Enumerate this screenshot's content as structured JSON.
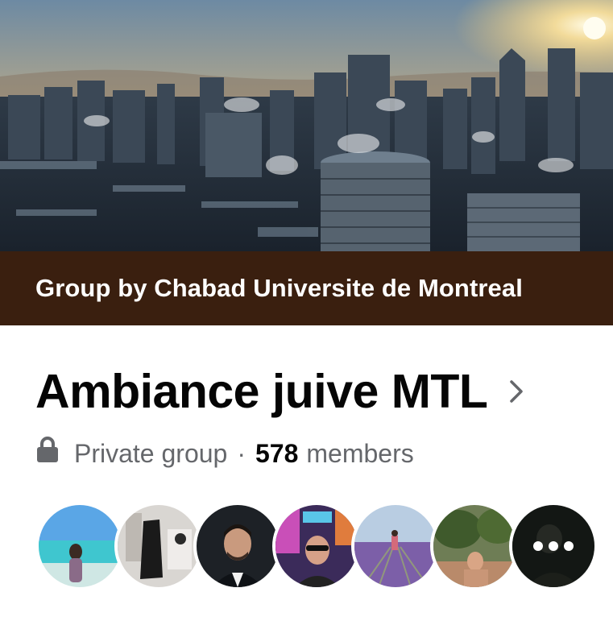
{
  "cover": {
    "icon": "city-skyline-cover-photo",
    "colors": {
      "sky_top": "#7b98b0",
      "sky_glow": "#f0b04c",
      "sun": "#fff6d8",
      "city": "#34404c"
    }
  },
  "owner_bar": {
    "text": "Group by Chabad Universite de Montreal",
    "background": "#3a1f0f"
  },
  "group": {
    "name": "Ambiance juive MTL",
    "privacy": "Private group",
    "separator": "·",
    "member_count": "578",
    "members_label": "members"
  },
  "icons": {
    "lock": "lock-icon",
    "chevron": "chevron-right-icon",
    "more": "more-members-icon"
  },
  "member_avatars": [
    {
      "description": "beach-avatar"
    },
    {
      "description": "boutique-avatar"
    },
    {
      "description": "portrait-avatar"
    },
    {
      "description": "arcade-avatar"
    },
    {
      "description": "lavender-field-avatar"
    },
    {
      "description": "garden-avatar"
    },
    {
      "description": "dark-avatar-with-more"
    }
  ]
}
